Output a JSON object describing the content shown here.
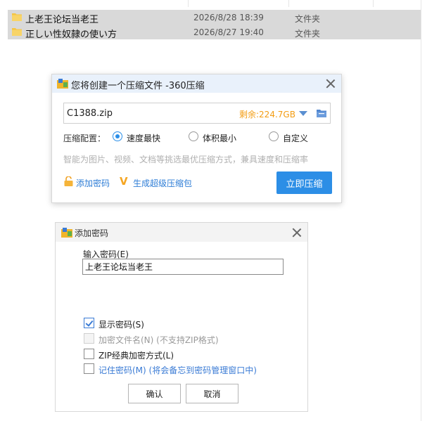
{
  "explorer": {
    "files": [
      {
        "name": "上老王论坛当老王",
        "date": "2026/8/28 18:39",
        "type": "文件夹"
      },
      {
        "name": "正しい性奴隷の使い方",
        "date": "2026/8/27 19:40",
        "type": "文件夹"
      }
    ]
  },
  "zip_dialog": {
    "title": "您将创建一个压缩文件 -360压缩",
    "filename": "C1388.zip",
    "space_left": "剩余:224.7GB",
    "config_label": "压缩配置：",
    "options": [
      "速度最快",
      "体积最小",
      "自定义"
    ],
    "selected_option": "速度最快",
    "hint": "智能为图片、视频、文档等挑选最优压缩方式，兼具速度和压缩率",
    "add_password_link": "添加密码",
    "super_pack_link": "生成超级压缩包",
    "compress_button": "立即压缩"
  },
  "password_dialog": {
    "title": "添加密码",
    "input_label": "输入密码(E)",
    "password_value": "上老王论坛当老王",
    "show_password": "显示密码(S)",
    "encrypt_filenames": "加密文件名(N) (不支持ZIP格式)",
    "zip_classic": "ZIP经典加密方式(L)",
    "remember_password": "记住密码(M) (将会备忘到密码管理窗口中)",
    "ok_button": "确认",
    "cancel_button": "取消"
  },
  "colors": {
    "accent_blue": "#2c8ee6",
    "space_orange": "#f39c12",
    "link_blue": "#2e7dd6"
  }
}
